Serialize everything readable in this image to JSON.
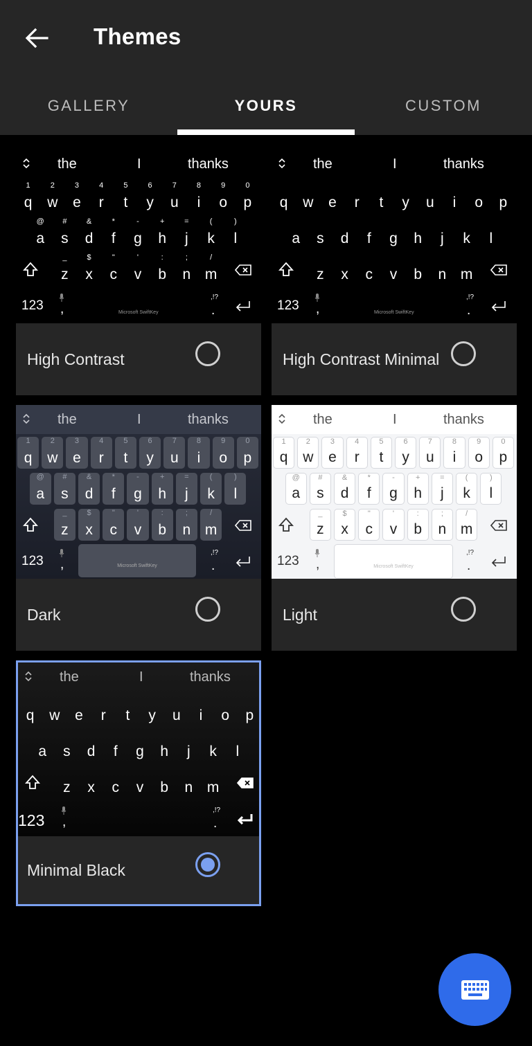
{
  "header": {
    "title": "Themes"
  },
  "tabs": [
    {
      "label": "GALLERY"
    },
    {
      "label": "YOURS"
    },
    {
      "label": "CUSTOM"
    }
  ],
  "keyboard_preview": {
    "suggestions": [
      "the",
      "I",
      "thanks"
    ],
    "row1": [
      [
        "q",
        "1"
      ],
      [
        "w",
        "2"
      ],
      [
        "e",
        "3"
      ],
      [
        "r",
        "4"
      ],
      [
        "t",
        "5"
      ],
      [
        "y",
        "6"
      ],
      [
        "u",
        "7"
      ],
      [
        "i",
        "8"
      ],
      [
        "o",
        "9"
      ],
      [
        "p",
        "0"
      ]
    ],
    "row2": [
      [
        "a",
        "@"
      ],
      [
        "s",
        "#"
      ],
      [
        "d",
        "&"
      ],
      [
        "f",
        "*"
      ],
      [
        "g",
        "-"
      ],
      [
        "h",
        "+"
      ],
      [
        "j",
        "="
      ],
      [
        "k",
        "("
      ],
      [
        "l",
        ")"
      ]
    ],
    "row3": [
      [
        "z",
        "_"
      ],
      [
        "x",
        "$"
      ],
      [
        "c",
        "\""
      ],
      [
        "v",
        "'"
      ],
      [
        "b",
        ":"
      ],
      [
        "n",
        ";"
      ],
      [
        "m",
        "/"
      ]
    ],
    "numbers_key": "123",
    "comma": ",",
    "period": ".",
    "punct_hint": ",!?",
    "brand": "Microsoft SwiftKey"
  },
  "themes": [
    {
      "name": "High Contrast",
      "selected": false
    },
    {
      "name": "High Contrast Minimal",
      "selected": false
    },
    {
      "name": "Dark",
      "selected": false
    },
    {
      "name": "Light",
      "selected": false
    },
    {
      "name": "Minimal Black",
      "selected": true
    }
  ],
  "colors": {
    "appbar": "#262626",
    "background": "#000000",
    "accent": "#7ba0f0",
    "fab": "#2f6bea"
  }
}
